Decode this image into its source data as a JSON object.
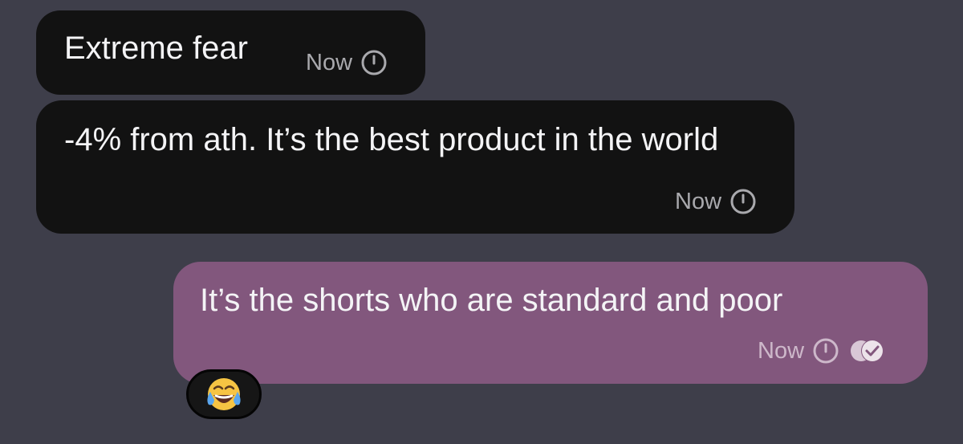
{
  "chat": {
    "messages": [
      {
        "direction": "incoming",
        "text": "Extreme fear",
        "time": "Now",
        "status_icon": "clock-icon"
      },
      {
        "direction": "incoming",
        "text": "-4% from ath. It’s the best product in the world",
        "time": "Now",
        "status_icon": "clock-icon"
      },
      {
        "direction": "outgoing",
        "text": "It’s the shorts who are standard and poor",
        "time": "Now",
        "status_icon": "clock-icon",
        "read_icon": "double-check-icon",
        "reaction": {
          "emoji": "😂",
          "icon": "face-with-tears-of-joy-icon"
        }
      }
    ]
  },
  "colors": {
    "background": "#3e3e4a",
    "incoming_bubble": "#121212",
    "outgoing_bubble": "#82577d",
    "text": "#f4f4f6"
  }
}
